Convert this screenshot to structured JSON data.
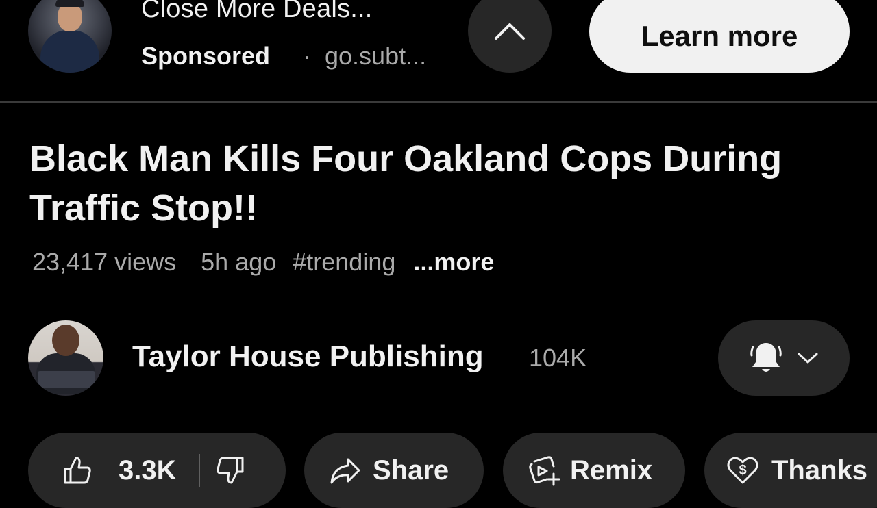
{
  "ad": {
    "title": "Close More Deals...",
    "sponsored_label": "Sponsored",
    "separator": "·",
    "domain": "go.subt...",
    "cta_label": "Learn more"
  },
  "video": {
    "title": "Black Man Kills Four Oakland Cops During Traffic Stop!!",
    "views": "23,417 views",
    "time_ago": "5h ago",
    "hashtag": "#trending",
    "more_label": "...more"
  },
  "channel": {
    "name": "Taylor House Publishing",
    "subscribers": "104K"
  },
  "actions": {
    "like_count": "3.3K",
    "share_label": "Share",
    "remix_label": "Remix",
    "thanks_label": "Thanks"
  },
  "icons": {
    "collapse": "chevron-up-icon",
    "like": "thumbs-up-icon",
    "dislike": "thumbs-down-icon",
    "share": "share-arrow-icon",
    "remix": "remix-icon",
    "thanks": "heart-dollar-icon",
    "notifications": "bell-icon"
  },
  "colors": {
    "background": "#000000",
    "surface": "#272727",
    "text_primary": "#f1f1f1",
    "text_secondary": "#aaaaaa",
    "cta_background": "#f1f1f1"
  }
}
